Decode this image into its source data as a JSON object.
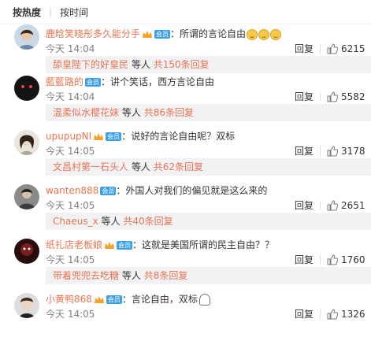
{
  "tabs": {
    "hot": "按热度",
    "sep": "|",
    "time": "按时间"
  },
  "labels": {
    "reply": "回复",
    "colon": "：",
    "etc": "等人",
    "total_prefix": "共",
    "total_suffix": "条回复"
  },
  "colors": {
    "accent": "#eb7350",
    "link": "#eb7350",
    "badge": "#3ba0e6"
  },
  "comments": [
    {
      "user": "鹿晗笑晓彤多久能分手",
      "text": "所谓的言论自由",
      "emoji": "smile-icon x3",
      "time": "今天 14:04",
      "likes": "6215",
      "sub_user": "舔皇陛下的好皇民",
      "sub_count": "150"
    },
    {
      "user": "藍藍路的",
      "text": "讲个笑话，西方言论自由",
      "time": "今天 14:04",
      "likes": "5582",
      "sub_user": "温柔似水樱花妹",
      "sub_count": "86"
    },
    {
      "user": "upupupNI",
      "text": "说好的言论自由呢？双标",
      "time": "今天 14:05",
      "likes": "3178",
      "sub_user": "文昌村第一石头人",
      "sub_count": "62"
    },
    {
      "user": "wanten888",
      "text": "外国人对我们的偏见就是这么来的",
      "time": "今天 14:05",
      "likes": "2651",
      "sub_user": "Chaeus_x",
      "sub_count": "40"
    },
    {
      "user": "纸扎店老板娘",
      "text": "这就是美国所谓的民主自由？？",
      "time": "今天 14:05",
      "likes": "1760",
      "sub_user": "带着兜兜去吃糖",
      "sub_count": "8"
    },
    {
      "user": "小黄鸭868",
      "text": "言论自由，双标",
      "emoji": "ghost-icon",
      "time": "今天 14:05",
      "likes": "1326"
    }
  ]
}
